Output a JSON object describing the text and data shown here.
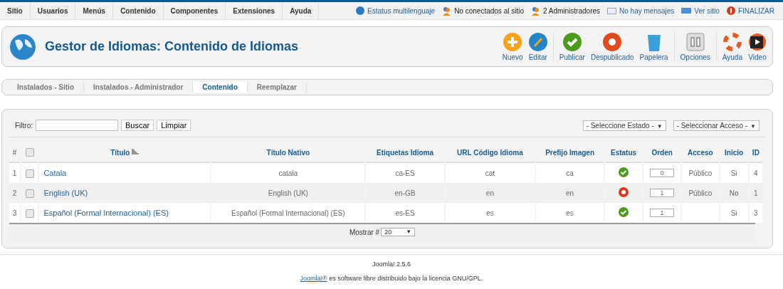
{
  "menu": [
    "Sitio",
    "Usuarios",
    "Menús",
    "Contenido",
    "Componentes",
    "Extensiones",
    "Ayuda"
  ],
  "status": [
    {
      "kind": "globe",
      "label": "Estatus multilenguaje",
      "link": true
    },
    {
      "kind": "user",
      "label": "No conectados al sitio",
      "link": false
    },
    {
      "kind": "user",
      "label": "2 Administradores",
      "link": false
    },
    {
      "kind": "mail",
      "label": "No hay mensajes",
      "link": true
    },
    {
      "kind": "screen",
      "label": "Ver sitio",
      "link": true
    },
    {
      "kind": "logout",
      "label": "FINALIZAR",
      "link": true
    }
  ],
  "header": {
    "title": "Gestor de Idiomas: Contenido de Idiomas"
  },
  "toolbar": [
    [
      {
        "kind": "new",
        "label": "Nuevo"
      },
      {
        "kind": "edit",
        "label": "Editar"
      }
    ],
    [
      {
        "kind": "publish",
        "label": "Publicar"
      },
      {
        "kind": "unpublish",
        "label": "Despublicado"
      },
      {
        "kind": "trash",
        "label": "Papelera"
      }
    ],
    [
      {
        "kind": "options",
        "label": "Opciones"
      }
    ],
    [
      {
        "kind": "help",
        "label": "Ayuda"
      },
      {
        "kind": "video",
        "label": "Video"
      }
    ]
  ],
  "tabs": [
    {
      "label": "Instalados - Sitio",
      "selected": false
    },
    {
      "label": "Instalados - Administrador",
      "selected": false
    },
    {
      "label": "Contenido",
      "selected": true
    },
    {
      "label": "Reemplazar",
      "selected": false
    }
  ],
  "filter": {
    "label": "Filtro:",
    "search_button": "Buscar",
    "clear_button": "Limpiar",
    "state_select": "- Seleccione Estado -",
    "access_select": "- Seleccionar Acceso -",
    "caret": "▼"
  },
  "table": {
    "columns": [
      "#",
      "Título",
      "Título Nativo",
      "Etiquetas Idioma",
      "URL Código Idioma",
      "Prefijo Imagen",
      "Estatus",
      "Orden",
      "Acceso",
      "Inicio",
      "ID"
    ],
    "all_checked": false,
    "rows": [
      {
        "num": "1",
        "checked": false,
        "title": "Catala",
        "native": "catala",
        "tag": "ca-ES",
        "url_code": "cat",
        "prefix": "ca",
        "published": true,
        "order": "0",
        "access": "Público",
        "home": "Si",
        "id": "4"
      },
      {
        "num": "2",
        "checked": false,
        "title": "English (UK)",
        "native": "English (UK)",
        "tag": "en-GB",
        "url_code": "en",
        "prefix": "en",
        "published": false,
        "order": "1",
        "access": "Público",
        "home": "No",
        "id": "1"
      },
      {
        "num": "3",
        "checked": false,
        "title": "Español (Formal Internacional) (ES)",
        "native": "Español (Formal Internacional) (ES)",
        "tag": "es-ES",
        "url_code": "es",
        "prefix": "es",
        "published": true,
        "order": "1",
        "access": "",
        "home": "Si",
        "id": "3"
      }
    ],
    "show_label": "Mostrar #",
    "show_value": "20",
    "show_caret": "▼"
  },
  "footer": {
    "version": "Joomla! 2.5.6",
    "license_link": "Joomla!®",
    "license_text": "es software libre distribuido bajo la licencia GNU/GPL."
  }
}
